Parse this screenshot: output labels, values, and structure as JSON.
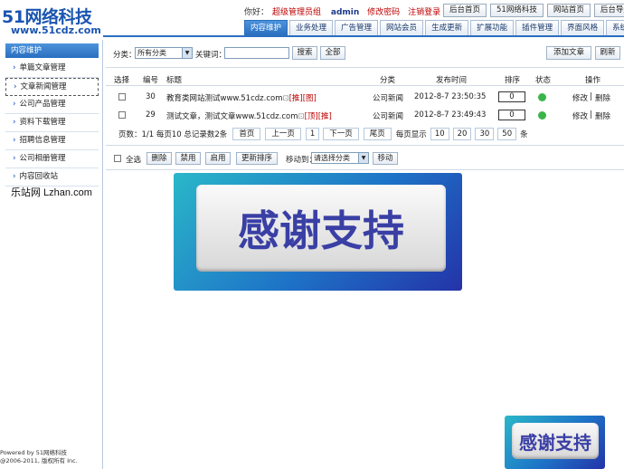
{
  "brand": {
    "logo": "51网络科技",
    "url": "www.51cdz.com"
  },
  "userbar": {
    "greeting": "你好：",
    "role": "超级管理员组",
    "username": "admin",
    "change_pwd": "修改密码",
    "logout": "注销登录",
    "arrows": "«  »"
  },
  "top_buttons": [
    "后台首页",
    "51网络科技",
    "网站首页",
    "后台导航"
  ],
  "nav_tabs": [
    "内容维护",
    "业务处理",
    "广告管理",
    "网站会员",
    "生成更新",
    "扩展功能",
    "插件管理",
    "界面风格",
    "系统设置"
  ],
  "sidebar": {
    "header": "内容维护",
    "items": [
      "单篇文章管理",
      "文章新闻管理",
      "公司产品管理",
      "资料下载管理",
      "招聘信息管理",
      "公司相册管理",
      "内容回收站"
    ],
    "active_index": 1,
    "watermark": "乐站网 Lzhan.com",
    "footer_line1": "Powered by 51网络科技",
    "footer_line2": "@2006-2011, 版权所有 Inc."
  },
  "filter": {
    "category_label": "分类：",
    "category_value": "所有分类",
    "keyword_label": "关键词：",
    "search_button": "搜索",
    "all_button": "全部",
    "add_button": "添加文章",
    "refresh_button": "刷新"
  },
  "table": {
    "headers": [
      "选择",
      "编号",
      "标题",
      "分类",
      "发布时间",
      "排序",
      "状态",
      "操作"
    ],
    "rows": [
      {
        "id": "30",
        "title": "教育类网站测试www.51cdz.com",
        "tags": "[推][图]",
        "category": "公司新闻",
        "time": "2012-8-7 23:50:35",
        "sort": "0",
        "edit": "修改",
        "delete": "删除"
      },
      {
        "id": "29",
        "title": "测试文章，测试文章www.51cdz.com",
        "tags": "[顶][推]",
        "category": "公司新闻",
        "time": "2012-8-7 23:49:43",
        "sort": "0",
        "edit": "修改",
        "delete": "删除"
      }
    ],
    "sep": "|",
    "img_icon": "⊡"
  },
  "pager": {
    "summary": "页数：1/1 每页10 总记录数2条",
    "first": "首页",
    "prev": "上一页",
    "current": "1",
    "next": "下一页",
    "last": "尾页",
    "per_page_label": "每页显示",
    "per_page_options": [
      "10",
      "20",
      "30",
      "50"
    ],
    "unit": "条"
  },
  "actions": {
    "select_all": "全选",
    "delete": "删除",
    "disable": "禁用",
    "enable": "启用",
    "update_sort": "更新排序",
    "move_to_label": "移动到：",
    "move_select": "请选择分类",
    "move_button": "移动"
  },
  "overlay": {
    "text": "感谢支持"
  },
  "colors": {
    "accent": "#2a6fc0",
    "link_red": "#b00000",
    "status_ok": "#39b54a"
  }
}
